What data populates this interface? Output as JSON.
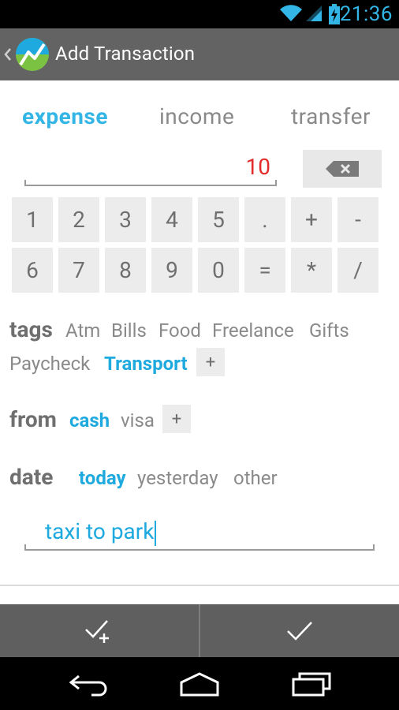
{
  "status_bar": {
    "time": "21:36",
    "icons": [
      "wifi-icon",
      "signal-icon",
      "battery-charging-icon"
    ]
  },
  "action_bar": {
    "title": "Add Transaction",
    "icon": "app-logo-icon"
  },
  "type_tabs": [
    "expense",
    "income",
    "transfer"
  ],
  "selected_type": "expense",
  "amount": "10",
  "keypad": {
    "row1": [
      "1",
      "2",
      "3",
      "4",
      "5",
      ".",
      "+",
      "-"
    ],
    "row2": [
      "6",
      "7",
      "8",
      "9",
      "0",
      "=",
      "*",
      "/"
    ]
  },
  "tags": {
    "label": "tags",
    "items": [
      "Atm",
      "Bills",
      "Food",
      "Freelance",
      "Gifts",
      "Paycheck",
      "Transport"
    ],
    "selected": "Transport",
    "add_label": "+"
  },
  "from": {
    "label": "from",
    "items": [
      "cash",
      "visa"
    ],
    "selected": "cash",
    "add_label": "+"
  },
  "date": {
    "label": "date",
    "items": [
      "today",
      "yesterday",
      "other"
    ],
    "selected": "today"
  },
  "note": "taxi to park",
  "bottom_actions": [
    "save-and-new-icon",
    "save-icon"
  ],
  "nav": [
    "back-icon",
    "home-icon",
    "recents-icon"
  ],
  "colors": {
    "accent": "#33b5e5",
    "amount": "#e32b2b",
    "action_bar": "#636363"
  }
}
